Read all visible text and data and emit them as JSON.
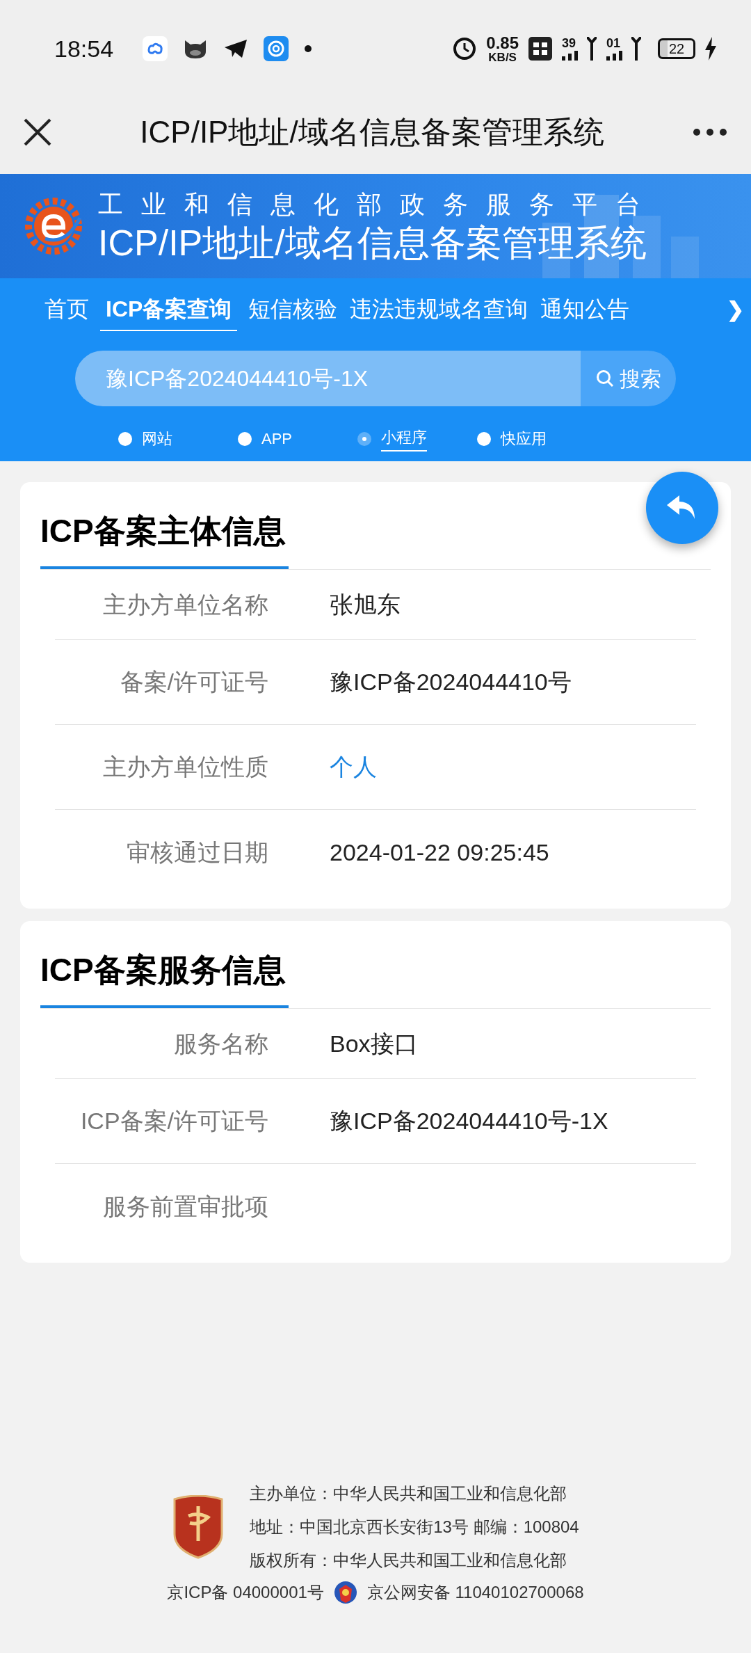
{
  "status_bar": {
    "time": "18:54",
    "net_speed": "0.85",
    "net_unit": "KB/S",
    "sim1_label": "39",
    "sim2_label": "01",
    "battery": "22"
  },
  "app_bar": {
    "title": "ICP/IP地址/域名信息备案管理系统"
  },
  "banner": {
    "subtitle": "工业和信息化部政务服务平台",
    "title": "ICP/IP地址/域名信息备案管理系统"
  },
  "nav": [
    {
      "label": "首页",
      "selected": false
    },
    {
      "label": "ICP备案查询",
      "selected": true
    },
    {
      "label": "短信核验",
      "selected": false
    },
    {
      "label": "违法违规域名查询",
      "selected": false
    },
    {
      "label": "通知公告",
      "selected": false
    }
  ],
  "nav_more": "❯",
  "search": {
    "value": "豫ICP备2024044410号-1X",
    "button": "搜索"
  },
  "types": [
    {
      "label": "网站",
      "selected": false
    },
    {
      "label": "APP",
      "selected": false
    },
    {
      "label": "小程序",
      "selected": true
    },
    {
      "label": "快应用",
      "selected": false
    }
  ],
  "sections": [
    {
      "title": "ICP备案主体信息",
      "rows": [
        {
          "label": "主办方单位名称",
          "value": "张旭东",
          "kind": "text"
        },
        {
          "label": "备案/许可证号",
          "value": "豫ICP备2024044410号",
          "kind": "text"
        },
        {
          "label": "主办方单位性质",
          "value": "个人",
          "kind": "link"
        },
        {
          "label": "审核通过日期",
          "value": "2024-01-22 09:25:45",
          "kind": "text"
        }
      ]
    },
    {
      "title": "ICP备案服务信息",
      "rows": [
        {
          "label": "服务名称",
          "value": "Box接口",
          "kind": "text"
        },
        {
          "label": "ICP备案/许可证号",
          "value": "豫ICP备2024044410号-1X",
          "kind": "text"
        },
        {
          "label": "服务前置审批项"
        }
      ]
    }
  ],
  "footer": {
    "lines": [
      "主办单位：中华人民共和国工业和信息化部",
      "地址：中国北京西长安街13号 邮编：100804",
      "版权所有：中华人民共和国工业和信息化部"
    ],
    "icp": "京ICP备 04000001号",
    "police": "京公网安备 11040102700068"
  }
}
